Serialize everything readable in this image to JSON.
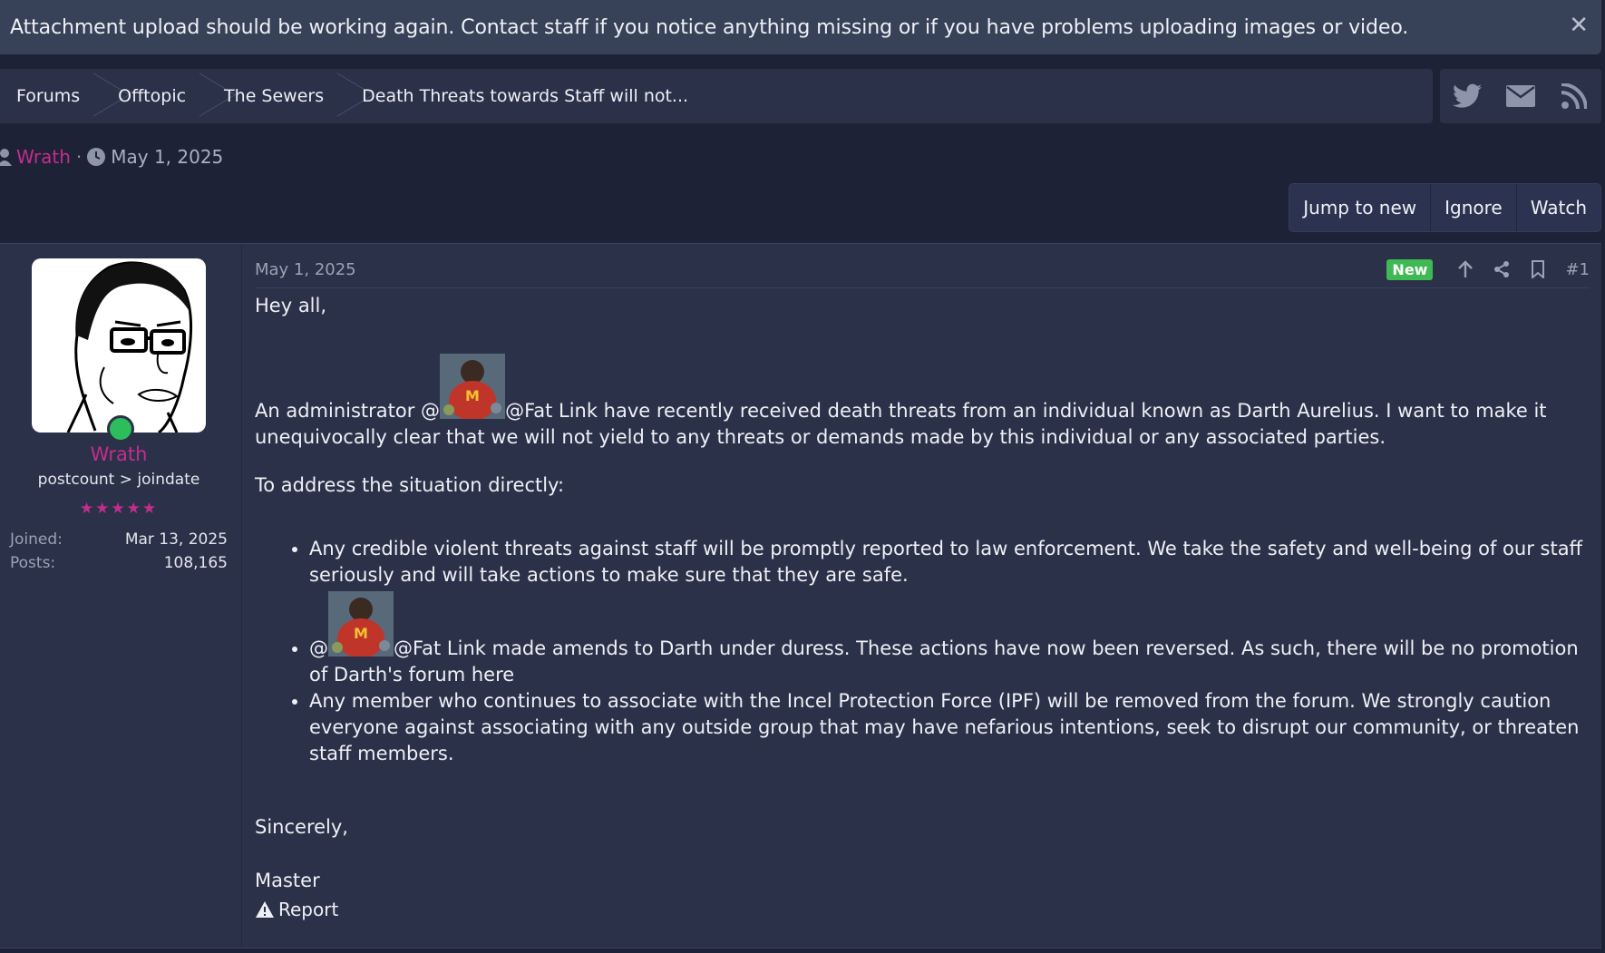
{
  "notice": {
    "text": "Attachment upload should be working again. Contact staff if you notice anything missing or if you have problems uploading images or video.",
    "close_icon": "close-icon"
  },
  "breadcrumb": {
    "items": [
      "Forums",
      "Offtopic",
      "The Sewers",
      "Death Threats towards Staff will not..."
    ]
  },
  "social": [
    "twitter-icon",
    "mail-icon",
    "rss-icon"
  ],
  "thread_meta": {
    "author": "Wrath",
    "separator": "·",
    "date": "May 1, 2025"
  },
  "thread_actions": [
    "Jump to new",
    "Ignore",
    "Watch"
  ],
  "user": {
    "name": "Wrath",
    "title": "postcount > joindate",
    "stars": "★★★★★",
    "joined_label": "Joined:",
    "joined_value": "Mar 13, 2025",
    "posts_label": "Posts:",
    "posts_value": "108,165"
  },
  "post": {
    "date": "May 1, 2025",
    "badge": "New",
    "number": "#1",
    "greeting": "Hey all,",
    "para1_prefix": "An administrator @",
    "para1_rest": "@Fat Link have recently received death threats from an individual known as Darth Aurelius. I want to make it unequivocally clear that we will not yield to any threats or demands made by this individual or any associated parties.",
    "para2": "To address the situation directly:",
    "bullet1": "Any credible violent threats against staff will be promptly reported to law enforcement. We take the safety and well-being of our staff seriously and will take actions to make sure that they are safe.",
    "bullet2_prefix": "@",
    "bullet2_rest": "@Fat Link made amends to Darth under duress. These actions have now been reversed. As such, there will be no promotion of Darth's forum here",
    "bullet3": "Any member who continues to associate with the Incel Protection Force (IPF) will be removed from the forum. We strongly caution everyone against associating with any outside group that may have nefarious intentions, seek to disrupt our community, or threaten staff members.",
    "signoff": "Sincerely,",
    "signature": "Master",
    "report_label": "Report"
  },
  "colors": {
    "accent_pink": "#c42d8e",
    "new_badge": "#3eb954",
    "online": "#2ebd5d"
  }
}
